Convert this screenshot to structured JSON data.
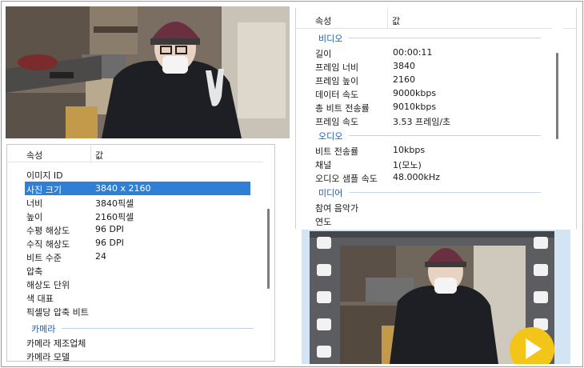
{
  "left_panel": {
    "header": {
      "property": "속성",
      "value": "값"
    },
    "rows": [
      {
        "key": "이미지 ID",
        "value": ""
      },
      {
        "key": "사진 크기",
        "value": "3840 x 2160"
      },
      {
        "key": "너비",
        "value": "3840픽셀"
      },
      {
        "key": "높이",
        "value": "2160픽셀"
      },
      {
        "key": "수평 해상도",
        "value": "96 DPI"
      },
      {
        "key": "수직 해상도",
        "value": "96 DPI"
      },
      {
        "key": "비트 수준",
        "value": "24"
      },
      {
        "key": "압축",
        "value": ""
      },
      {
        "key": "해상도 단위",
        "value": ""
      },
      {
        "key": "색 대표",
        "value": ""
      },
      {
        "key": "픽셀당 압축 비트",
        "value": ""
      }
    ],
    "selected_row": "사진 크기",
    "group": "카메라",
    "group_rows": [
      {
        "key": "카메라 제조업체",
        "value": ""
      },
      {
        "key": "카메라 모델",
        "value": ""
      }
    ]
  },
  "right_panel": {
    "header": {
      "property": "속성",
      "value": "값"
    },
    "video_group": "비디오",
    "video_rows": [
      {
        "key": "길이",
        "value": "00:00:11"
      },
      {
        "key": "프레임 너비",
        "value": "3840"
      },
      {
        "key": "프레임 높이",
        "value": "2160"
      },
      {
        "key": "데이터 속도",
        "value": "9000kbps"
      },
      {
        "key": "총 비트 전송률",
        "value": "9010kbps"
      },
      {
        "key": "프레임 속도",
        "value": "3.53 프레임/초"
      }
    ],
    "audio_group": "오디오",
    "audio_rows": [
      {
        "key": "비트 전송률",
        "value": "10kbps"
      },
      {
        "key": "채널",
        "value": "1(모노)"
      },
      {
        "key": "오디오 샘플 속도",
        "value": "48.000kHz"
      }
    ],
    "media_group": "미디어",
    "media_rows": [
      {
        "key": "참여 음악가",
        "value": ""
      },
      {
        "key": "연도",
        "value": ""
      }
    ]
  },
  "colors": {
    "selection": "#2f7fd6",
    "group_heading": "#1b5fb4",
    "play_button": "#f3c518",
    "thumbnail_background": "#d3e5f5"
  },
  "icons": {
    "play": "play-icon",
    "film_strip": "film-strip-icon"
  }
}
